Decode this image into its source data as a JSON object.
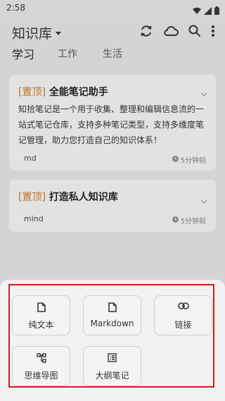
{
  "status": {
    "time": "2:58"
  },
  "app_bar": {
    "title": "知识库"
  },
  "tabs": [
    {
      "label": "学习"
    },
    {
      "label": "工作"
    },
    {
      "label": "生活"
    }
  ],
  "notes": [
    {
      "pin": "[置顶]",
      "title": "全能笔记助手",
      "body": "知拾笔记是一个用于收集、整理和编辑信息流的一站式笔记仓库，支持多种笔记类型，支持多维度笔记管理，助力您打造自己的知识体系！",
      "tag": "md",
      "time": "5分钟前"
    },
    {
      "pin": "[置顶]",
      "title": "打造私人知识库",
      "tag": "mind",
      "time": "5分钟前"
    }
  ],
  "new_note_sheet": {
    "options": [
      {
        "label": "纯文本",
        "icon": "file-icon"
      },
      {
        "label": "Markdown",
        "icon": "file-icon"
      },
      {
        "label": "链接",
        "icon": "link-icon"
      },
      {
        "label": "思维导图",
        "icon": "mind-map-icon"
      },
      {
        "label": "大纲笔记",
        "icon": "outline-icon"
      }
    ]
  },
  "colors": {
    "pin": "#c07527",
    "highlight": "#d41c1c",
    "scrim": "#d4d4d4",
    "sheet": "#f2f2f2"
  }
}
